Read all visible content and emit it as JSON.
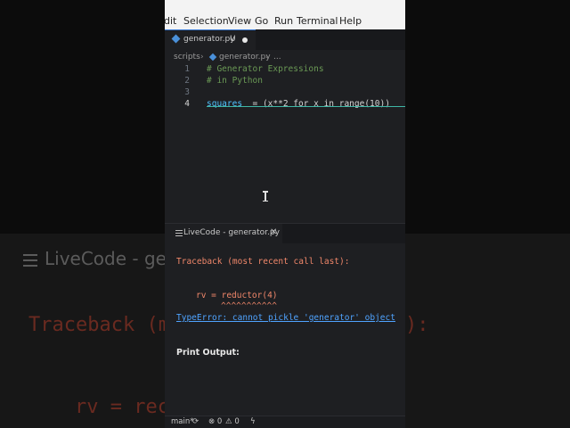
{
  "backdrop": {
    "tab_label": "LiveCode - gen",
    "trace_text": "Traceback (m",
    "trace_end": "):",
    "rv_text": "rv = rec"
  },
  "menu": [
    "dit",
    "Selection",
    "View",
    "Go",
    "Run",
    "Terminal",
    "Help"
  ],
  "editor_tab": {
    "label": "generator.py",
    "status": "U"
  },
  "breadcrumb": {
    "folder": "scripts",
    "file": "generator.py",
    "more": "..."
  },
  "code": {
    "line_numbers": [
      "1",
      "2",
      "3",
      "4"
    ],
    "line1": "# Generator Expressions",
    "line2": "# in Python",
    "line4_var": "squares",
    "line4_eq": "  = ",
    "line4_rest": "(x**2 for x in range(10))"
  },
  "panel_tab": {
    "label": "LiveCode - generator.py",
    "close": "✕"
  },
  "output": {
    "traceback": "Traceback (most recent call last):",
    "rv_line": "rv = reductor(4)",
    "caret_line": "^^^^^^^^^^^",
    "error": "TypeError: cannot pickle 'generator' object",
    "print_output": "Print Output:"
  },
  "statusbar": {
    "branch": "main*",
    "sync": "⟳",
    "errors": "0",
    "warnings": "0",
    "bolt": "ϟ"
  },
  "colors": {
    "editor_bg": "#1e1f22",
    "comment": "#6a9955",
    "traceback": "#f0876a",
    "error_link": "#4fa3ff",
    "current_line_underline": "#3fb7a6"
  }
}
